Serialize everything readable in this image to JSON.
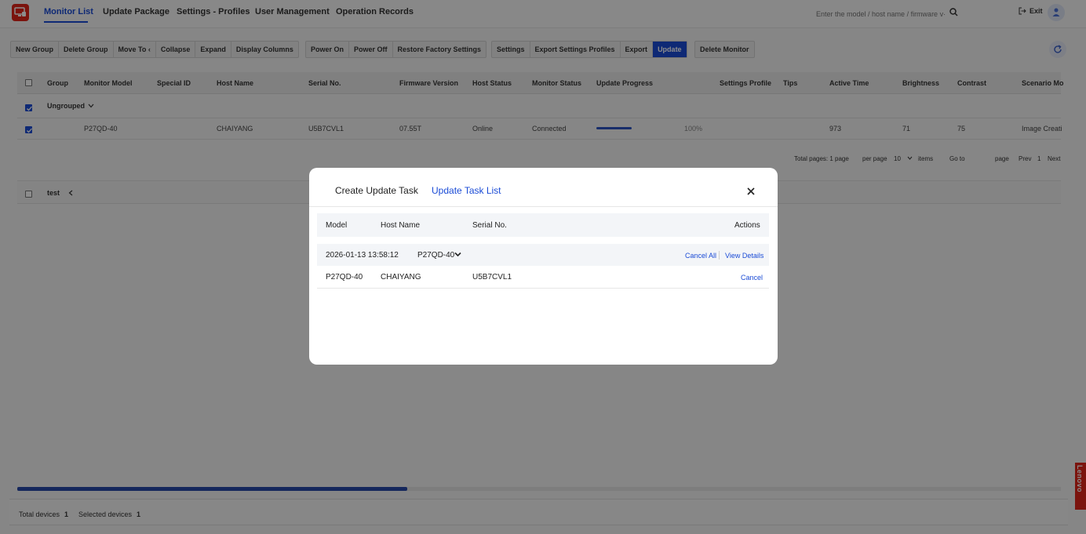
{
  "header": {
    "nav": [
      "Monitor List",
      "Update Package",
      "Settings - Profiles",
      "User Management",
      "Operation Records"
    ],
    "search_placeholder": "Enter the model / host name / firmware v···",
    "exit_label": "Exit"
  },
  "toolbar": {
    "group1": [
      "New Group",
      "Delete Group",
      "Move To ‹",
      "Collapse",
      "Expand",
      "Display Columns"
    ],
    "group2": [
      "Power On",
      "Power Off",
      "Restore Factory Settings"
    ],
    "group3": [
      "Settings",
      "Export Settings Profiles",
      "Export",
      "Update"
    ],
    "group4": [
      "Delete Monitor"
    ]
  },
  "table": {
    "columns": [
      "Group",
      "Monitor Model",
      "Special ID",
      "Host Name",
      "Serial No.",
      "Firmware Version",
      "Host Status",
      "Monitor Status",
      "Update Progress",
      "Settings Profile",
      "Tips",
      "Active Time",
      "Brightness",
      "Contrast",
      "Scenario Mo"
    ],
    "group_name": "Ungrouped",
    "row": {
      "model": "P27QD-40",
      "host": "CHAIYANG",
      "serial": "U5B7CVL1",
      "firmware": "07.55T",
      "host_status": "Online",
      "monitor_status": "Connected",
      "progress": 1.0,
      "progress_label": "100%",
      "active_time": "973",
      "brightness": "71",
      "contrast": "75",
      "scenario": "Image Creati"
    },
    "pagination": {
      "total_pages": "Total pages: 1 page",
      "per_page_label": "per page",
      "per_page_value": "10",
      "items_label": "items",
      "go_to": "Go to",
      "page_label": "page",
      "prev": "Prev",
      "current": "1",
      "next": "Next"
    },
    "group2_name": "test"
  },
  "footer": {
    "total_label": "Total devices",
    "total_value": "1",
    "selected_label": "Selected devices",
    "selected_value": "1"
  },
  "side_tab": "Lenovo",
  "modal": {
    "tab_create": "Create Update Task",
    "tab_list": "Update Task List",
    "columns": [
      "Model",
      "Host Name",
      "Serial No.",
      "Actions"
    ],
    "task": {
      "datetime": "2026-01-13 13:58:12",
      "model": "P27QD-40",
      "cancel_all": "Cancel All",
      "view_details": "View Details"
    },
    "row": {
      "model": "P27QD-40",
      "host": "CHAIYANG",
      "serial": "U5B7CVL1",
      "cancel": "Cancel"
    }
  },
  "colors": {
    "accent": "#1a4bd6",
    "brand": "#e1251b"
  }
}
